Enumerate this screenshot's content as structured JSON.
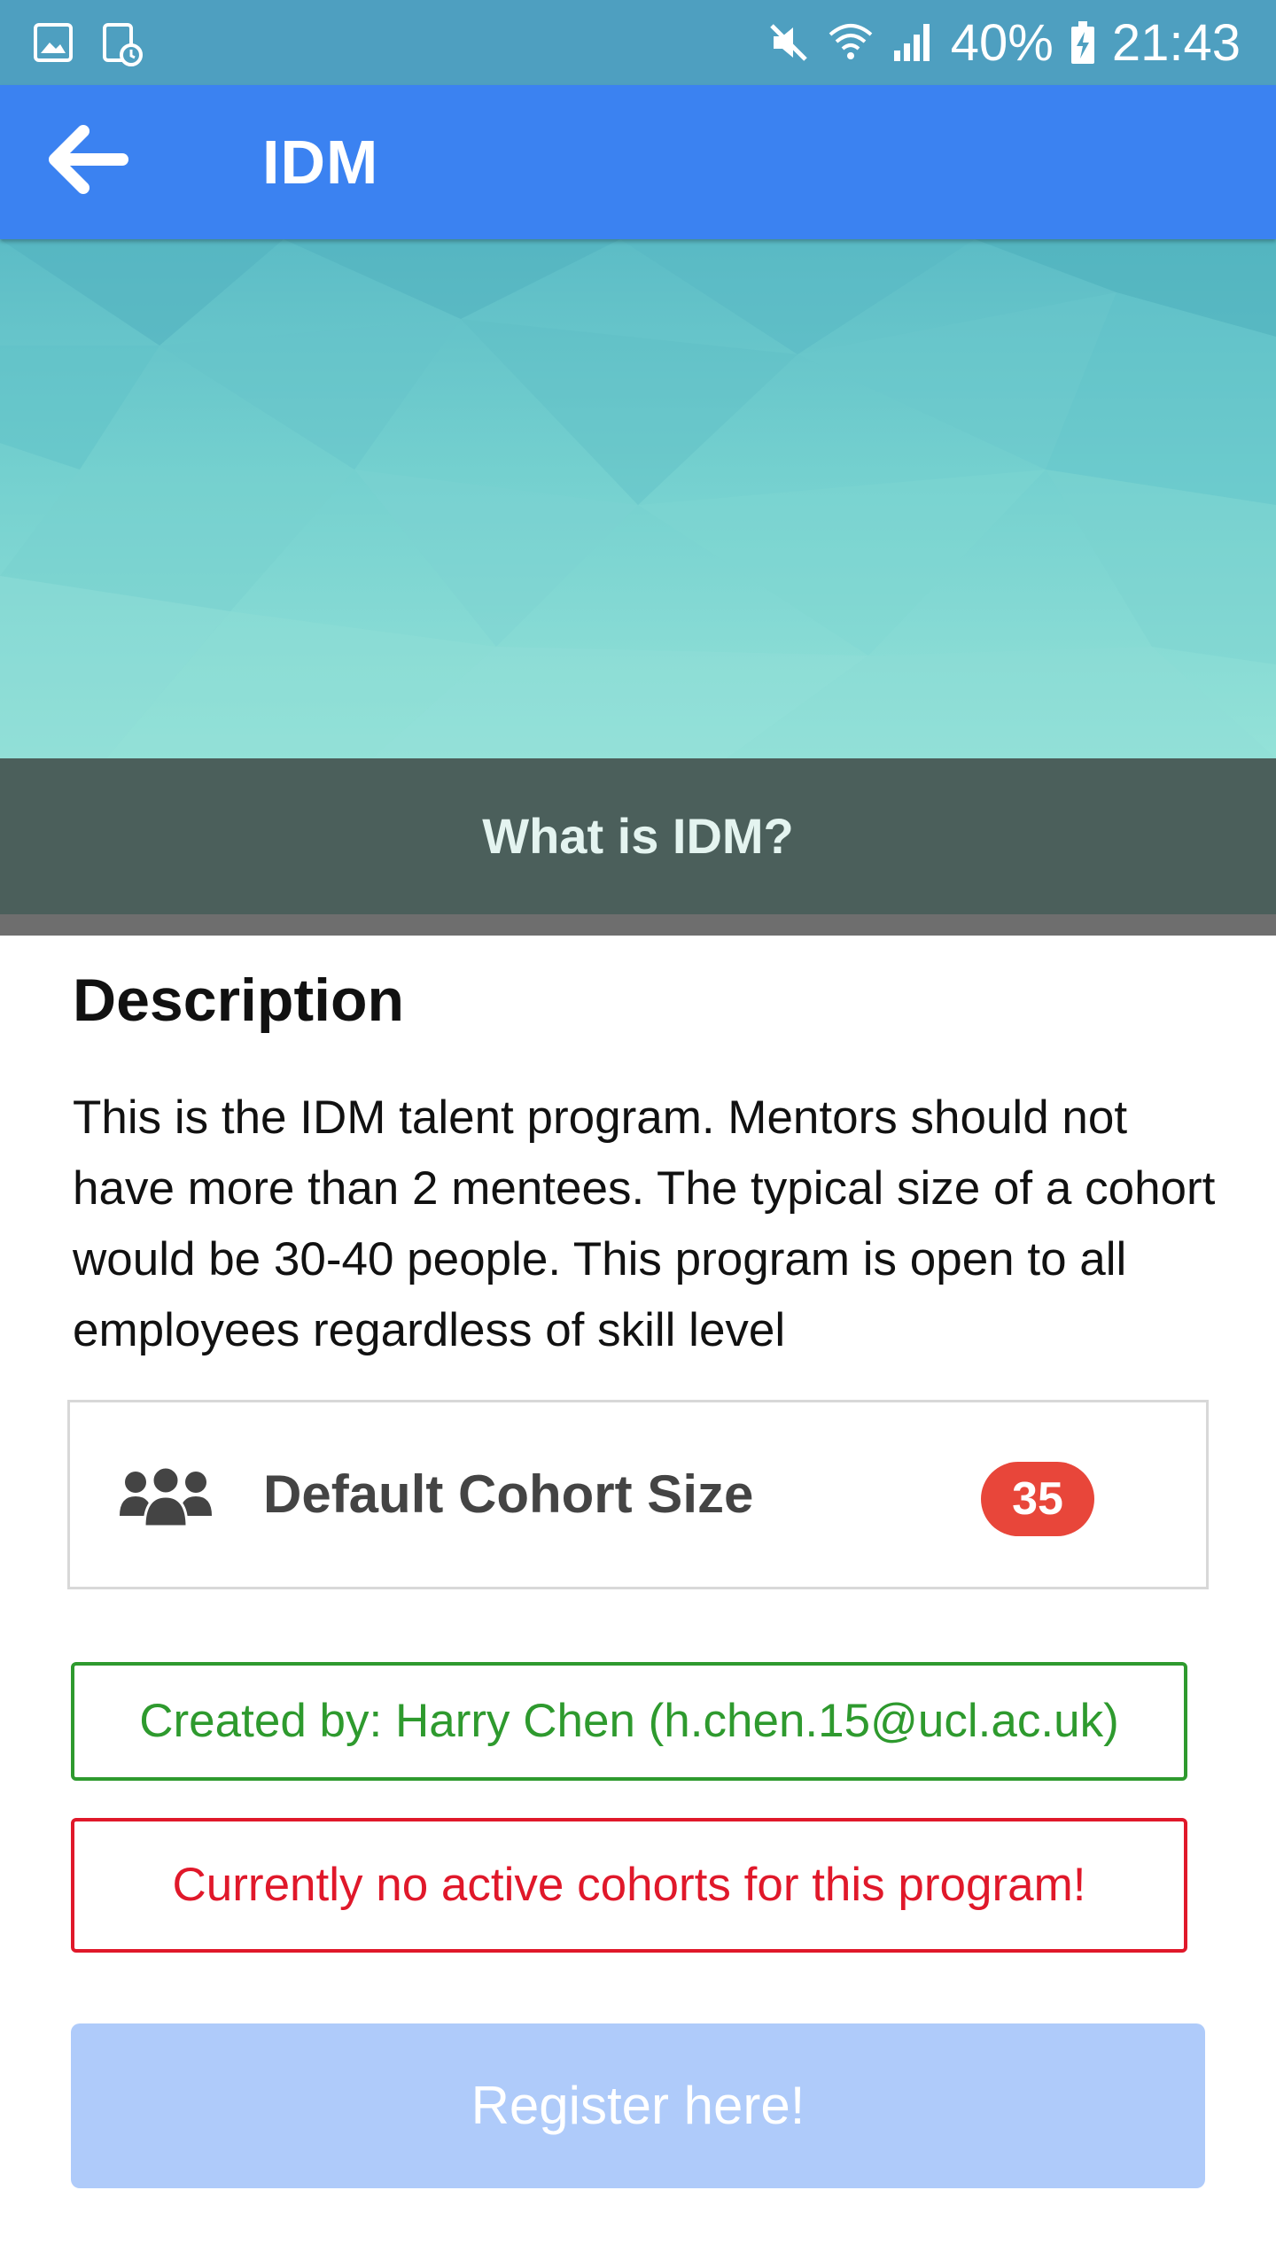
{
  "status_bar": {
    "battery": "40%",
    "time": "21:43",
    "left_icons": [
      "gallery-icon",
      "screen-time-icon"
    ],
    "right_icons": [
      "mute-icon",
      "wifi-icon",
      "signal-icon",
      "battery-charging-icon"
    ]
  },
  "app_bar": {
    "title": "IDM",
    "back_icon": "arrow-left-icon"
  },
  "hero": {
    "caption": "What is IDM?"
  },
  "description": {
    "heading": "Description",
    "text": "This is the IDM talent program. Mentors should not have more than 2 mentees. The typical size of a cohort would be 30-40 people. This program is open to all employees regardless of skill level"
  },
  "cohort": {
    "icon": "group-icon",
    "label": "Default Cohort Size",
    "value": "35"
  },
  "created_by": "Created by: Harry Chen (h.chen.15@ucl.ac.uk)",
  "alert": "Currently no active cohorts for this program!",
  "register_button": "Register here!",
  "colors": {
    "status_bar": "#4e9fc0",
    "app_bar": "#3b82f1",
    "badge": "#e8463a",
    "success": "#2e9a2e",
    "danger": "#e0182a",
    "button_disabled": "#afcbfa"
  }
}
